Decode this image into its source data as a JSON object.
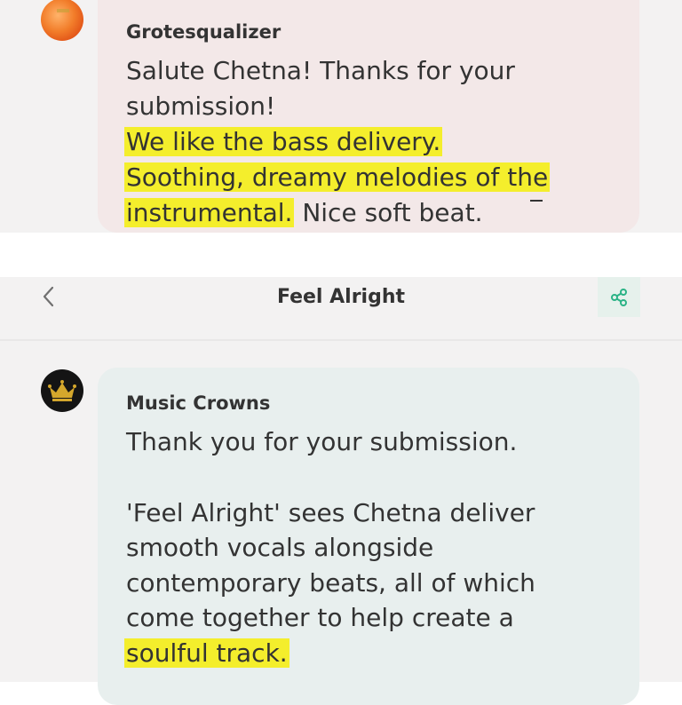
{
  "top_message": {
    "sender": "Grotesqualizer",
    "lines": [
      {
        "plain": "Salute Chetna! Thanks for your",
        "highlight": "",
        "after": ""
      },
      {
        "plain": "submission!",
        "highlight": "",
        "after": ""
      },
      {
        "plain": "",
        "highlight": "We like the bass delivery.",
        "after": ""
      },
      {
        "plain": "",
        "highlight": "Soothing, dreamy melodies of the",
        "after": ""
      },
      {
        "plain": "",
        "highlight": "instrumental.",
        "after": " Nice soft beat."
      }
    ]
  },
  "header": {
    "title": "Feel Alright",
    "back_icon": "chevron-left-icon",
    "share_icon": "share-icon",
    "accent_color": "#2bb386"
  },
  "bottom_message": {
    "sender": "Music Crowns",
    "lines": [
      {
        "plain": "Thank you for your submission.",
        "highlight": ""
      },
      {
        "plain": "'Feel Alright' sees Chetna deliver",
        "highlight": ""
      },
      {
        "plain": "smooth vocals alongside",
        "highlight": ""
      },
      {
        "plain": "contemporary beats, all of which",
        "highlight": ""
      },
      {
        "plain": "come together to help create a",
        "highlight": ""
      },
      {
        "plain": "",
        "highlight": "soulful track."
      }
    ]
  },
  "colors": {
    "highlight": "#f4ee2c",
    "top_bubble": "#f3e8e8",
    "bottom_bubble": "#e8efee",
    "background": "#f3f2f2"
  }
}
